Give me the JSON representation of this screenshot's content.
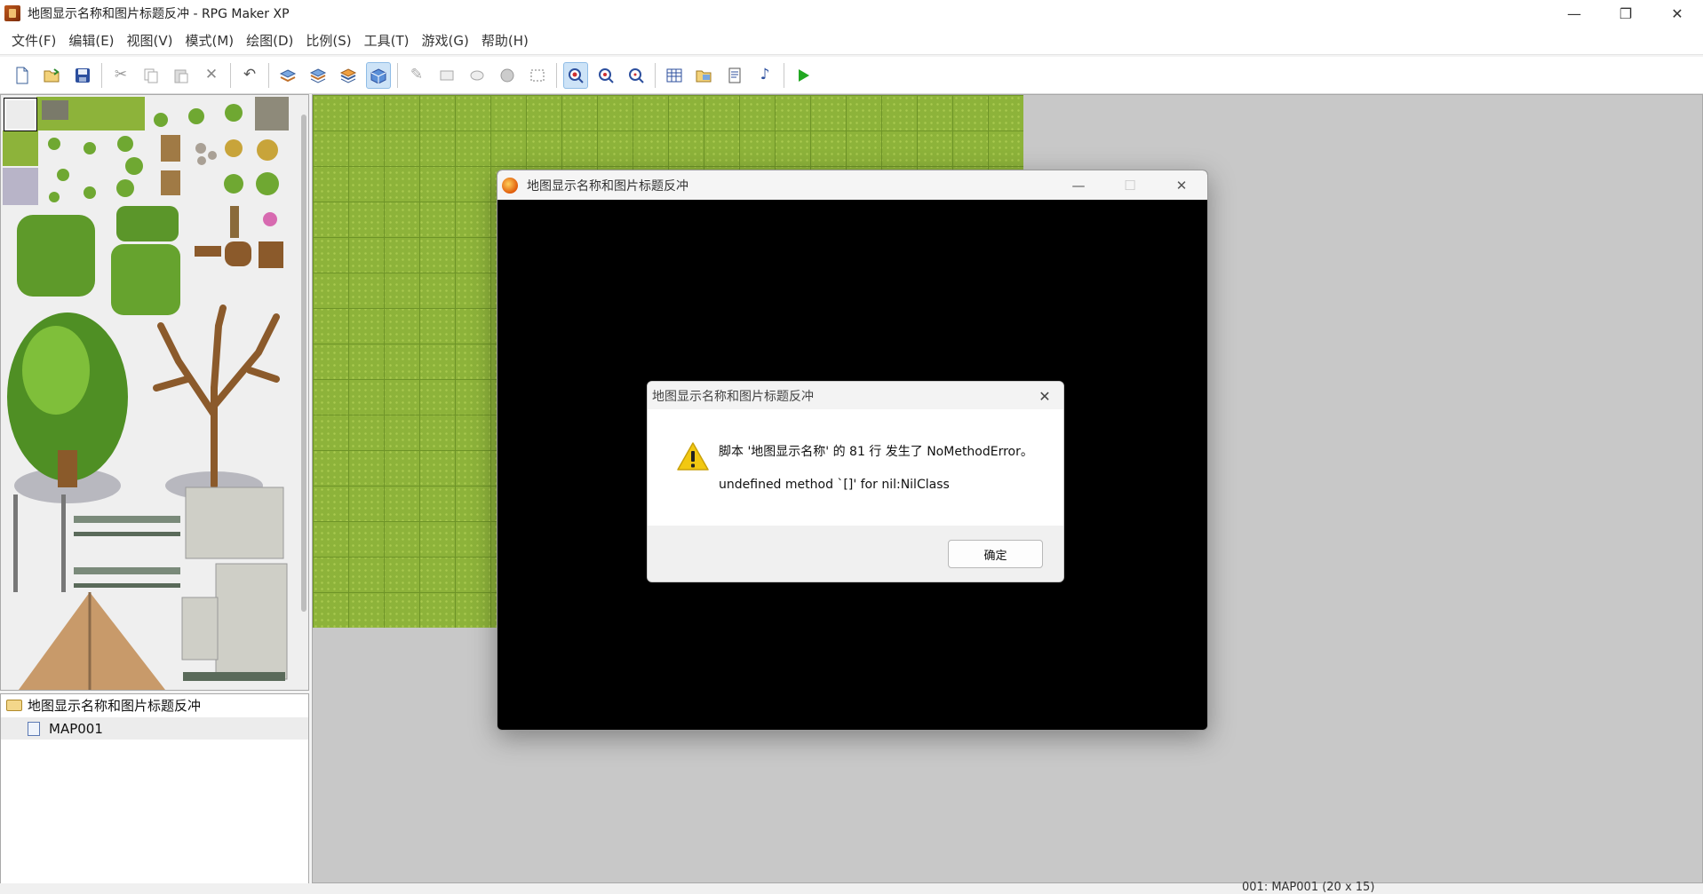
{
  "window": {
    "title": "地图显示名称和图片标题反冲 - RPG Maker XP",
    "controls": [
      "minimize-icon",
      "restore-icon",
      "close-icon"
    ]
  },
  "menu": [
    "文件(F)",
    "编辑(E)",
    "视图(V)",
    "模式(M)",
    "绘图(D)",
    "比例(S)",
    "工具(T)",
    "游戏(G)",
    "帮助(H)"
  ],
  "toolbar": {
    "groups": [
      [
        "new-file-icon",
        "open-project-icon",
        "save-icon"
      ],
      [
        "cut-icon",
        "copy-icon",
        "paste-icon",
        "delete-icon"
      ],
      [
        "undo-icon"
      ],
      [
        "layer1-icon",
        "layer2-icon",
        "layer3-icon",
        "event-layer-icon"
      ],
      [
        "pencil-icon",
        "rectangle-icon",
        "ellipse-icon",
        "fill-icon",
        "select-icon"
      ],
      [
        "zoom-1-1-icon",
        "zoom-1-2-icon",
        "zoom-1-4-icon"
      ],
      [
        "database-icon",
        "materials-icon",
        "script-editor-icon",
        "sound-test-icon"
      ],
      [
        "playtest-icon"
      ]
    ],
    "active": [
      "event-layer-icon",
      "zoom-1-1-icon"
    ]
  },
  "map_tree": {
    "root": "地图显示名称和图片标题反冲",
    "children": [
      "MAP001"
    ]
  },
  "game_window": {
    "title": "地图显示名称和图片标题反冲"
  },
  "dialog": {
    "title": "地图显示名称和图片标题反冲",
    "line1": "脚本 '地图显示名称' 的 81 行 发生了 NoMethodError。",
    "line2": "undefined method `[]' for nil:NilClass",
    "ok_label": "确定",
    "icon": "warning-icon"
  },
  "status": {
    "map_info": "001: MAP001 (20 x 15)"
  },
  "colors": {
    "accent": "#0078d4",
    "warning": "#f2c811",
    "grass": "#8db33a",
    "map_bg": "#c8c8c8"
  }
}
